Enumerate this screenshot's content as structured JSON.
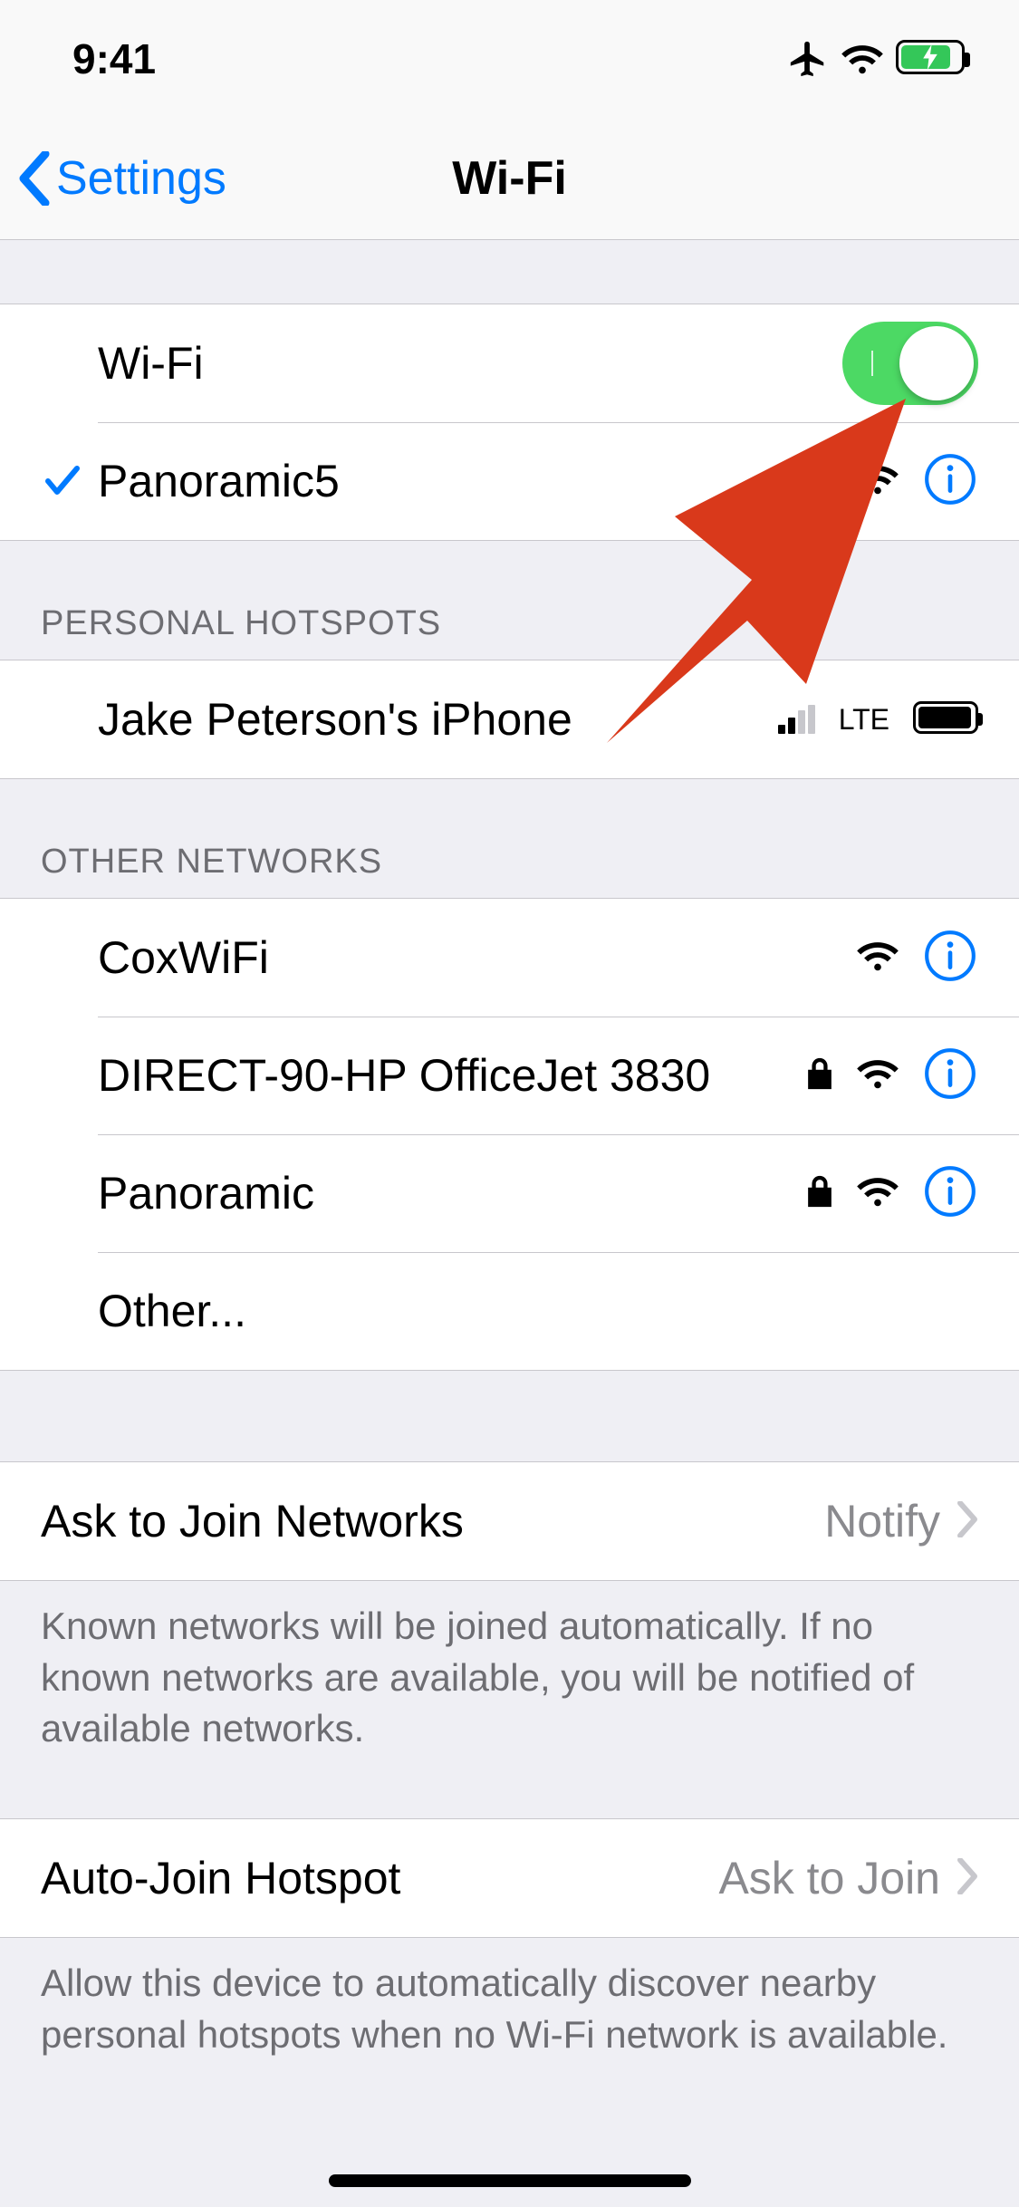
{
  "status": {
    "time": "9:41"
  },
  "nav": {
    "back": "Settings",
    "title": "Wi-Fi"
  },
  "wifi_toggle_label": "Wi-Fi",
  "connected": {
    "name": "Panoramic5",
    "secured": true
  },
  "sections": {
    "hotspots_header": "PERSONAL HOTSPOTS",
    "other_header": "OTHER NETWORKS"
  },
  "hotspots": [
    {
      "name": "Jake Peterson's iPhone",
      "signal_text": "LTE"
    }
  ],
  "other_networks": [
    {
      "name": "CoxWiFi",
      "secured": false
    },
    {
      "name": "DIRECT-90-HP OfficeJet 3830",
      "secured": true
    },
    {
      "name": "Panoramic",
      "secured": true
    }
  ],
  "other_row_label": "Other...",
  "ask_join": {
    "label": "Ask to Join Networks",
    "value": "Notify",
    "footer": "Known networks will be joined automatically. If no known networks are available, you will be notified of available networks."
  },
  "auto_hotspot": {
    "label": "Auto-Join Hotspot",
    "value": "Ask to Join",
    "footer": "Allow this device to automatically discover nearby personal hotspots when no Wi-Fi network is available."
  }
}
